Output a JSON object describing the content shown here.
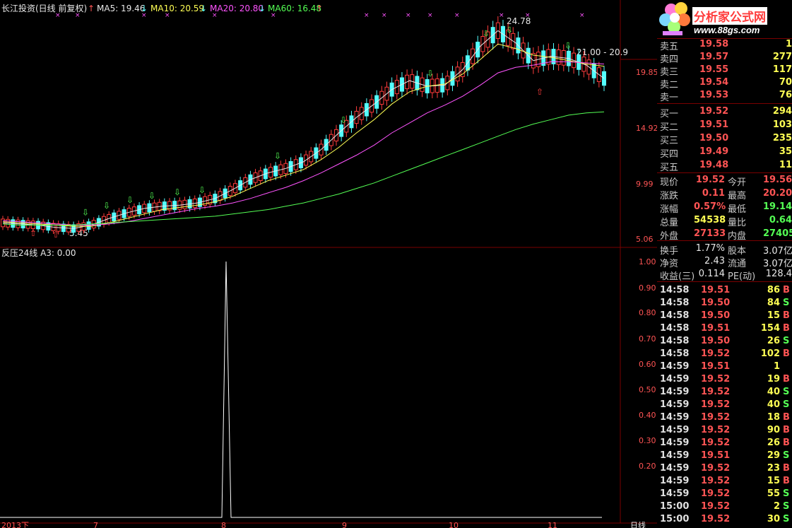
{
  "main_title": "长江投资(日线 前复权)",
  "ma": [
    {
      "label": "MA5: 19.46",
      "color": "#e8e8e8"
    },
    {
      "label": "MA10: 20.59",
      "color": "#ffff54"
    },
    {
      "label": "MA20: 20.80",
      "color": "#ff54ff"
    },
    {
      "label": "MA60: 16.48",
      "color": "#54ff54"
    }
  ],
  "sub_title": "反压24线  A3: 0.00",
  "price_axis_ticks": [
    "19.85",
    "14.92",
    "9.99",
    "5.06"
  ],
  "sub_axis_ticks": [
    "1.00",
    "0.90",
    "0.80",
    "0.70",
    "0.60",
    "0.50",
    "0.40",
    "0.30",
    "0.20"
  ],
  "annotations": {
    "high": "24.78",
    "low": "5.45",
    "range": "21.00 - 20.9"
  },
  "x_axis_labels": [
    "2013下",
    "7",
    "8",
    "9",
    "10",
    "11"
  ],
  "x_axis_right": "日线",
  "colors": {
    "up": "#ff3c3c",
    "down": "#54ffff",
    "ma5": "#e8e8e8",
    "ma10": "#ffff54",
    "ma20": "#ff54ff",
    "ma60": "#54ff54",
    "indicator": "#ffffff"
  },
  "logo": {
    "name": "分析家公式网",
    "url": "www.88gs.com",
    "mark": "flower-logo"
  },
  "orderbook": {
    "asks": [
      {
        "label": "卖五",
        "price": "19.58",
        "vol": "1"
      },
      {
        "label": "卖四",
        "price": "19.57",
        "vol": "277"
      },
      {
        "label": "卖三",
        "price": "19.55",
        "vol": "117"
      },
      {
        "label": "卖二",
        "price": "19.54",
        "vol": "70"
      },
      {
        "label": "卖一",
        "price": "19.53",
        "vol": "76"
      }
    ],
    "bids": [
      {
        "label": "买一",
        "price": "19.52",
        "vol": "294"
      },
      {
        "label": "买二",
        "price": "19.51",
        "vol": "103"
      },
      {
        "label": "买三",
        "price": "19.50",
        "vol": "235"
      },
      {
        "label": "买四",
        "price": "19.49",
        "vol": "35"
      },
      {
        "label": "买五",
        "price": "19.48",
        "vol": "11"
      }
    ]
  },
  "quote": [
    {
      "l1": "现价",
      "v1": "19.52",
      "c1": "red",
      "l2": "今开",
      "v2": "19.56",
      "c2": "red"
    },
    {
      "l1": "涨跌",
      "v1": "0.11",
      "c1": "red",
      "l2": "最高",
      "v2": "20.20",
      "c2": "red"
    },
    {
      "l1": "涨幅",
      "v1": "0.57%",
      "c1": "red",
      "l2": "最低",
      "v2": "19.14",
      "c2": "green"
    },
    {
      "l1": "总量",
      "v1": "54538",
      "c1": "yellow",
      "l2": "量比",
      "v2": "0.64",
      "c2": "green"
    },
    {
      "l1": "外盘",
      "v1": "27133",
      "c1": "red",
      "l2": "内盘",
      "v2": "27405",
      "c2": "green"
    }
  ],
  "fundamentals": [
    {
      "l1": "换手",
      "v1": "1.77%",
      "l2": "股本",
      "v2": "3.07亿"
    },
    {
      "l1": "净资",
      "v1": "2.43",
      "l2": "流通",
      "v2": "3.07亿"
    },
    {
      "l1": "收益(三)",
      "v1": "0.114",
      "l2": "PE(动)",
      "v2": "128.4"
    }
  ],
  "trades": [
    {
      "time": "14:58",
      "price": "19.51",
      "vol": "86",
      "side": "B"
    },
    {
      "time": "14:58",
      "price": "19.50",
      "vol": "84",
      "side": "S"
    },
    {
      "time": "14:58",
      "price": "19.50",
      "vol": "15",
      "side": "B"
    },
    {
      "time": "14:58",
      "price": "19.51",
      "vol": "154",
      "side": "B"
    },
    {
      "time": "14:58",
      "price": "19.50",
      "vol": "26",
      "side": "S"
    },
    {
      "time": "14:58",
      "price": "19.52",
      "vol": "102",
      "side": "B"
    },
    {
      "time": "14:59",
      "price": "19.51",
      "vol": "1",
      "side": ""
    },
    {
      "time": "14:59",
      "price": "19.52",
      "vol": "19",
      "side": "B"
    },
    {
      "time": "14:59",
      "price": "19.52",
      "vol": "40",
      "side": "S"
    },
    {
      "time": "14:59",
      "price": "19.52",
      "vol": "40",
      "side": "S"
    },
    {
      "time": "14:59",
      "price": "19.52",
      "vol": "18",
      "side": "B"
    },
    {
      "time": "14:59",
      "price": "19.52",
      "vol": "90",
      "side": "B"
    },
    {
      "time": "14:59",
      "price": "19.52",
      "vol": "26",
      "side": "B"
    },
    {
      "time": "14:59",
      "price": "19.51",
      "vol": "29",
      "side": "S"
    },
    {
      "time": "14:59",
      "price": "19.52",
      "vol": "23",
      "side": "B"
    },
    {
      "time": "14:59",
      "price": "19.52",
      "vol": "15",
      "side": "B"
    },
    {
      "time": "14:59",
      "price": "19.52",
      "vol": "55",
      "side": "S"
    },
    {
      "time": "15:00",
      "price": "19.52",
      "vol": "2",
      "side": "S"
    },
    {
      "time": "15:00",
      "price": "19.52",
      "vol": "30",
      "side": "S"
    }
  ],
  "chart_data": [
    {
      "type": "line",
      "name": "main_price_panel",
      "title": "长江投资(日线 前复权)",
      "ylim": [
        5.06,
        24.78
      ],
      "y_ticks": [
        19.85,
        14.92,
        9.99,
        5.06
      ],
      "series": [
        {
          "name": "MA5",
          "last": 19.46,
          "values": [
            6.5,
            6.4,
            6.3,
            6.1,
            6.0,
            6.3,
            6.9,
            7.4,
            7.8,
            8.0,
            8.1,
            8.3,
            8.7,
            9.5,
            10.4,
            11.0,
            11.4,
            12.0,
            13.1,
            14.6,
            16.0,
            17.2,
            18.5,
            19.3,
            18.8,
            18.9,
            20.3,
            22.4,
            23.8,
            22.7,
            21.1,
            21.5,
            21.3,
            20.7,
            19.5
          ]
        },
        {
          "name": "MA10",
          "last": 20.59,
          "values": [
            6.6,
            6.5,
            6.4,
            6.3,
            6.2,
            6.2,
            6.5,
            6.9,
            7.3,
            7.7,
            7.9,
            8.1,
            8.4,
            8.9,
            9.6,
            10.3,
            10.8,
            11.3,
            12.2,
            13.3,
            14.6,
            15.8,
            17.2,
            18.3,
            18.8,
            19.0,
            19.9,
            21.2,
            22.6,
            22.2,
            21.6,
            21.4,
            21.1,
            20.8,
            20.6
          ]
        },
        {
          "name": "MA20",
          "last": 20.8,
          "values": [
            6.7,
            6.6,
            6.5,
            6.4,
            6.3,
            6.3,
            6.4,
            6.6,
            6.9,
            7.2,
            7.5,
            7.8,
            8.0,
            8.3,
            8.7,
            9.2,
            9.7,
            10.3,
            11.0,
            11.8,
            12.6,
            13.5,
            14.6,
            15.5,
            16.4,
            17.1,
            17.9,
            18.9,
            20.0,
            20.5,
            20.7,
            21.0,
            21.0,
            20.9,
            20.8
          ]
        },
        {
          "name": "MA60",
          "last": 16.48,
          "values": [
            6.4,
            6.3,
            6.3,
            6.3,
            6.3,
            6.4,
            6.5,
            6.6,
            6.7,
            6.8,
            6.9,
            7.0,
            7.1,
            7.3,
            7.5,
            7.7,
            8.0,
            8.3,
            8.7,
            9.1,
            9.6,
            10.1,
            10.7,
            11.3,
            11.9,
            12.5,
            13.1,
            13.7,
            14.3,
            14.9,
            15.4,
            15.8,
            16.2,
            16.4,
            16.5
          ]
        }
      ],
      "annotations": [
        "24.78",
        "5.45",
        "21.00 - 20.9"
      ]
    },
    {
      "type": "line",
      "name": "反压24线",
      "title": "反压24线  A3: 0.00",
      "ylim": [
        0,
        1
      ],
      "y_ticks": [
        1.0,
        0.9,
        0.8,
        0.7,
        0.6,
        0.5,
        0.4,
        0.3,
        0.2
      ],
      "series": [
        {
          "name": "A3",
          "last": 0.0,
          "spike_value": 1.0
        }
      ]
    }
  ]
}
